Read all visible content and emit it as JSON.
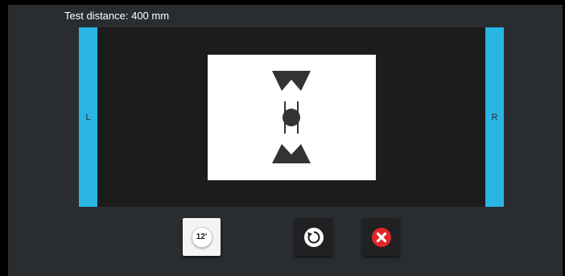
{
  "header": {
    "test_distance": "Test distance: 400 mm"
  },
  "stage": {
    "left_label": "L",
    "right_label": "R",
    "bar_color": "#29b6e4"
  },
  "target": {
    "shape": "two-triangle-pair-with-dot-and-gap-lines",
    "color": "#333333"
  },
  "controls": {
    "angle_label": "12'",
    "reset_icon": "rotate-icon",
    "close_icon": "close-x-icon",
    "close_color": "#e0262b"
  }
}
